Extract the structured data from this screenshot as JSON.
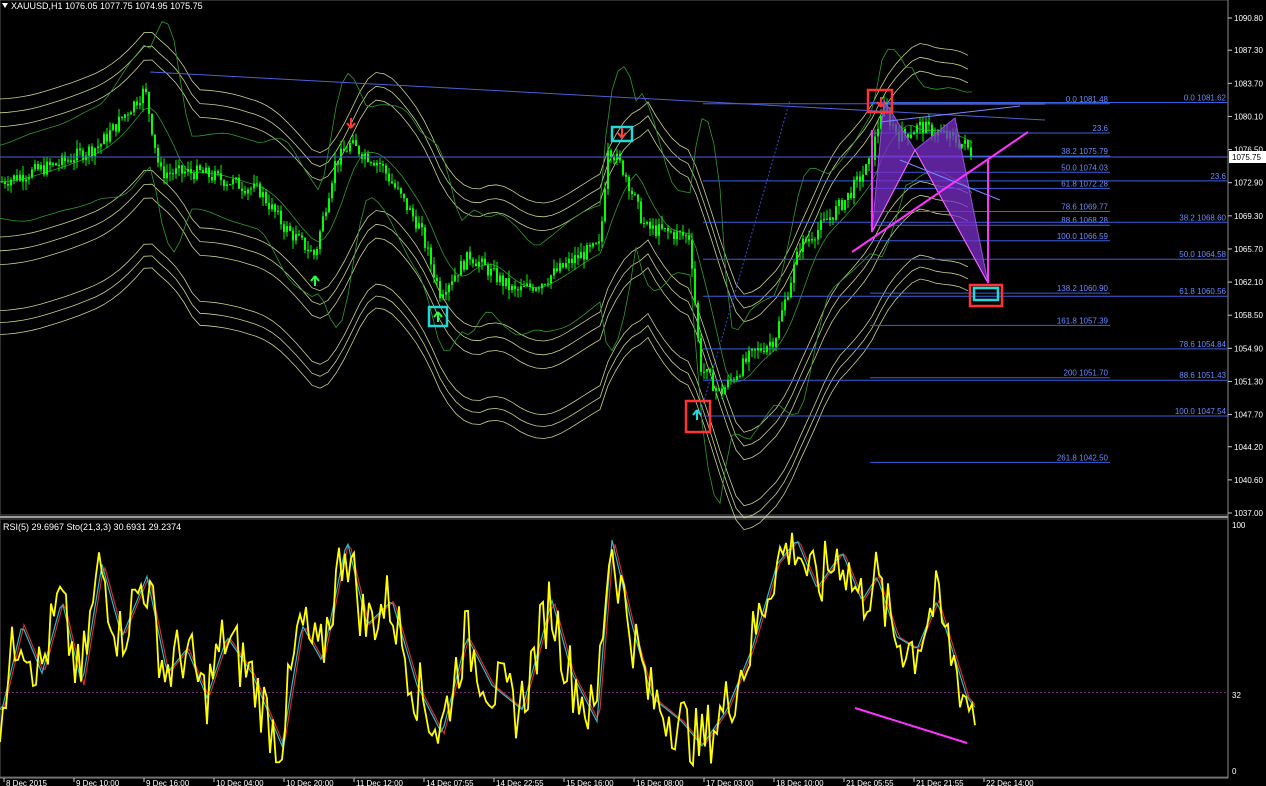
{
  "header": {
    "symbol_text": "XAUUSD,H1  1076.05  1077.75  1074.95  1075.75",
    "dropdown_icon": "triangle-down-icon"
  },
  "price_axis": {
    "labels": [
      "1090.80",
      "1087.30",
      "1083.70",
      "1080.10",
      "1076.50",
      "1072.90",
      "1069.30",
      "1065.70",
      "1062.10",
      "1058.50",
      "1054.90",
      "1051.30",
      "1047.70",
      "1044.20",
      "1040.60",
      "1037.00"
    ],
    "current_price": "1075.75"
  },
  "fib_levels": [
    {
      "label": "0.0 1081.48",
      "price": 1081.48
    },
    {
      "label": "0.0 1081.62",
      "price": 1081.62
    },
    {
      "label": "23.6",
      "price": 1078.3
    },
    {
      "label": "38.2 1075.79",
      "price": 1075.79
    },
    {
      "label": "50.0 1074.03",
      "price": 1074.03
    },
    {
      "label": "23.6",
      "price": 1073.1
    },
    {
      "label": "61.8 1072.28",
      "price": 1072.28
    },
    {
      "label": "78.6 1069.77",
      "price": 1069.77
    },
    {
      "label": "88.6 1068.28",
      "price": 1068.28
    },
    {
      "label": "38.2 1068.60",
      "price": 1068.6
    },
    {
      "label": "100.0 1066.59",
      "price": 1066.59
    },
    {
      "label": "50.0 1064.58",
      "price": 1064.58
    },
    {
      "label": "138.2 1060.90",
      "price": 1060.9
    },
    {
      "label": "61.8 1060.56",
      "price": 1060.56
    },
    {
      "label": "161.8 1057.39",
      "price": 1057.39
    },
    {
      "label": "78.6 1054.84",
      "price": 1054.84
    },
    {
      "label": "200 1051.70",
      "price": 1051.7
    },
    {
      "label": "88.6 1051.43",
      "price": 1051.43
    },
    {
      "label": "100.0 1047.54",
      "price": 1047.54
    },
    {
      "label": "261.8 1042.50",
      "price": 1042.5
    }
  ],
  "indicator": {
    "title": "RSI(5) 29.6967  Sto(21,3,3) 30.6931 29.2374",
    "scale": [
      "100",
      "32",
      "0"
    ]
  },
  "time_axis": {
    "labels": [
      "8 Dec 2015",
      "9 Dec 10:00",
      "9 Dec 16:00",
      "10 Dec 04:00",
      "10 Dec 20:00",
      "11 Dec 12:00",
      "14 Dec 07:55",
      "14 Dec 22:55",
      "15 Dec 16:00",
      "16 Dec 08:00",
      "17 Dec 03:00",
      "18 Dec 10:00",
      "21 Dec 05:55",
      "21 Dec 21:55",
      "22 Dec 14:00"
    ]
  },
  "colors": {
    "candle": "#00ff00",
    "bands": "#c8d28a",
    "fib": "#3a5fe0",
    "harmonic": "#7b2ec9",
    "pink": "#ff33ff",
    "rsi": "#ffff00",
    "signal_red": "#ff3333",
    "signal_cyan": "#22d8d8"
  },
  "icons": {
    "buy_arrow": "arrow-up-icon",
    "sell_arrow": "arrow-down-icon"
  }
}
